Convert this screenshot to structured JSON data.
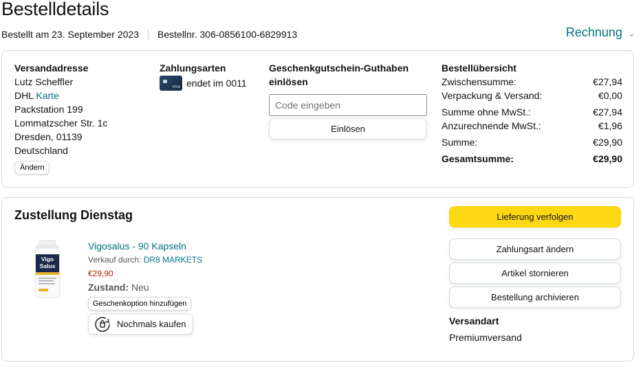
{
  "header": {
    "title": "Bestelldetails",
    "ordered_on": "Bestellt am 23. September 2023",
    "order_number": "Bestellnr. 306-0856100-6829913",
    "invoice_label": "Rechnung"
  },
  "address": {
    "heading": "Versandadresse",
    "name": "Lutz Scheffler",
    "carrier": "DHL",
    "carrier_link": "Karte",
    "line1": "Packstation 199",
    "line2": "Lommatzscher Str. 1c",
    "line3": "Dresden, 01139",
    "line4": "Deutschland",
    "change_label": "Ändern"
  },
  "payment": {
    "heading": "Zahlungsarten",
    "card_text": "endet im 0011",
    "card_brand": "VISA",
    "card_icon": "credit-card-icon"
  },
  "giftcard": {
    "heading": "Geschenkgutschein-Guthaben einlösen",
    "placeholder": "Code eingeben",
    "redeem_label": "Einlösen"
  },
  "summary": {
    "heading": "Bestellübersicht",
    "rows": [
      {
        "label": "Zwischensumme:",
        "value": "€27,94"
      },
      {
        "label": "Verpackung & Versand:",
        "value": "€0,00"
      },
      {
        "label": "Summe ohne MwSt.:",
        "value": "€27,94"
      },
      {
        "label": "Anzurechnende MwSt.:",
        "value": "€1,96"
      },
      {
        "label": "Summe:",
        "value": "€29,90"
      },
      {
        "label": "Gesamtsumme:",
        "value": "€29,90"
      }
    ]
  },
  "delivery": {
    "title": "Zustellung Dienstag",
    "product": {
      "title": "Vigosalus - 90 Kapseln",
      "seller_prefix": "Verkauf durch:",
      "seller": "DR8 MARKETS",
      "price": "€29,90",
      "condition_label": "Zustand:",
      "condition_value": "Neu",
      "gift_option_label": "Geschenkoption hinzufügen",
      "buy_again_label": "Nochmals kaufen",
      "image_brand": "Vigo Salus"
    },
    "actions": {
      "track": "Lieferung verfolgen",
      "change_payment": "Zahlungsart ändern",
      "cancel": "Artikel stornieren",
      "archive": "Bestellung archivieren"
    },
    "shipping_heading": "Versandart",
    "shipping_value": "Premiumversand"
  },
  "colors": {
    "link": "#007185",
    "price": "#b12704",
    "primary_button": "#ffd814"
  }
}
